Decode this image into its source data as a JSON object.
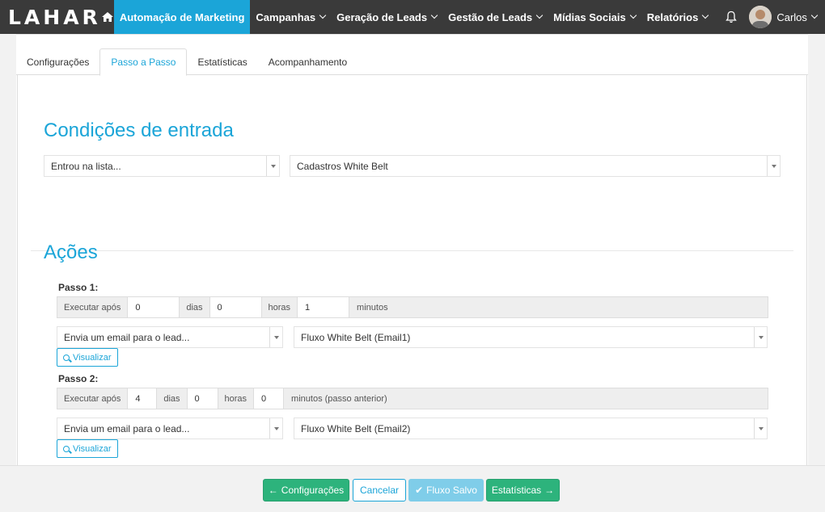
{
  "brand": {
    "logo": "LAHAR"
  },
  "nav": {
    "active": "Automação de Marketing",
    "items": [
      "Campanhas",
      "Geração de Leads",
      "Gestão de Leads",
      "Mídias Sociais",
      "Relatórios"
    ],
    "user": "Carlos"
  },
  "tabs": [
    "Configurações",
    "Passo a Passo",
    "Estatísticas",
    "Acompanhamento"
  ],
  "entry": {
    "title": "Condições de entrada",
    "condition": "Entrou na lista...",
    "list": "Cadastros White Belt"
  },
  "actions": {
    "title": "Ações",
    "steps": [
      {
        "label": "Passo 1:",
        "execute_after": "Executar após",
        "days_value": "0",
        "days_label": "dias",
        "hours_value": "0",
        "hours_label": "horas",
        "minutes_value": "1",
        "minutes_label": "minutos",
        "action": "Envia um email para o lead...",
        "email": "Fluxo White Belt (Email1)",
        "view": "Visualizar"
      },
      {
        "label": "Passo 2:",
        "execute_after": "Executar após",
        "days_value": "4",
        "days_label": "dias",
        "hours_value": "0",
        "hours_label": "horas",
        "minutes_value": "0",
        "minutes_label": "minutos (passo anterior)",
        "action": "Envia um email para o lead...",
        "email": "Fluxo White Belt (Email2)",
        "view": "Visualizar"
      }
    ]
  },
  "footer": {
    "back": "Configurações",
    "cancel": "Cancelar",
    "saved": "Fluxo Salvo",
    "next": "Estatísticas"
  },
  "colors": {
    "accent": "#1ba5d8",
    "nav_bg": "#3a3a3a",
    "success": "#2db37c"
  }
}
